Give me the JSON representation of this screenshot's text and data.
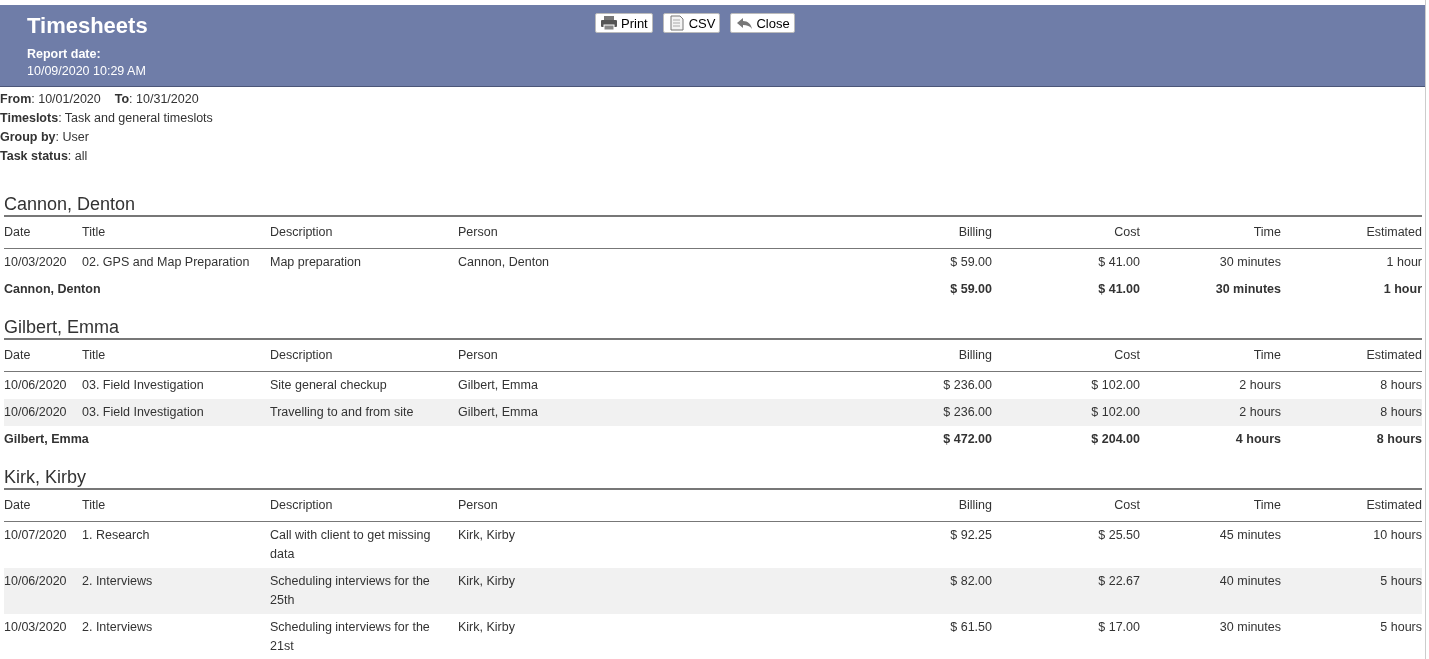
{
  "header": {
    "title": "Timesheets",
    "report_date_label": "Report date:",
    "report_date": "10/09/2020 10:29 AM"
  },
  "buttons": [
    {
      "kind": "print",
      "label": "Print"
    },
    {
      "kind": "csv",
      "label": "CSV"
    },
    {
      "kind": "close",
      "label": "Close"
    }
  ],
  "filters": [
    [
      "**From**: 10/01/2020",
      "**To**: 10/31/2020"
    ],
    [
      "**Timeslots**: Task and general timeslots"
    ],
    [
      "**Group by**: User"
    ],
    [
      "**Task status**: all"
    ]
  ],
  "groups": [
    {
      "name": "Cannon, Denton",
      "columns": [
        "Date",
        "Title",
        "Description",
        "Person",
        "Billing",
        "Cost",
        "Time",
        "Estimated"
      ],
      "rows": [
        [
          "10/03/2020",
          "02. GPS and Map Preparation",
          "Map preparation",
          "Cannon, Denton",
          "$ 59.00",
          "$ 41.00",
          "30 minutes",
          "1 hour"
        ]
      ],
      "total": {
        "label": "Cannon, Denton",
        "billing": "$ 59.00",
        "cost": "$ 41.00",
        "time": "30 minutes",
        "estimated": "1 hour"
      }
    },
    {
      "name": "Gilbert, Emma",
      "columns": [
        "Date",
        "Title",
        "Description",
        "Person",
        "Billing",
        "Cost",
        "Time",
        "Estimated"
      ],
      "rows": [
        [
          "10/06/2020",
          "03. Field Investigation",
          "Site general checkup",
          "Gilbert, Emma",
          "$ 236.00",
          "$ 102.00",
          "2 hours",
          "8 hours"
        ],
        [
          "10/06/2020",
          "03. Field Investigation",
          "Travelling to and from site",
          "Gilbert, Emma",
          "$ 236.00",
          "$ 102.00",
          "2 hours",
          "8 hours"
        ]
      ],
      "total": {
        "label": "Gilbert, Emma",
        "billing": "$ 472.00",
        "cost": "$ 204.00",
        "time": "4 hours",
        "estimated": "8 hours"
      }
    },
    {
      "name": "Kirk, Kirby",
      "columns": [
        "Date",
        "Title",
        "Description",
        "Person",
        "Billing",
        "Cost",
        "Time",
        "Estimated"
      ],
      "rows": [
        [
          "10/07/2020",
          "1. Research",
          "Call with client to get missing data",
          "Kirk, Kirby",
          "$ 92.25",
          "$ 25.50",
          "45 minutes",
          "10 hours"
        ],
        [
          "10/06/2020",
          "2. Interviews",
          "Scheduling interviews for the 25th",
          "Kirk, Kirby",
          "$ 82.00",
          "$ 22.67",
          "40 minutes",
          "5 hours"
        ],
        [
          "10/03/2020",
          "2. Interviews",
          "Scheduling interviews for the 21st",
          "Kirk, Kirby",
          "$ 61.50",
          "$ 17.00",
          "30 minutes",
          "5 hours"
        ]
      ]
    }
  ]
}
